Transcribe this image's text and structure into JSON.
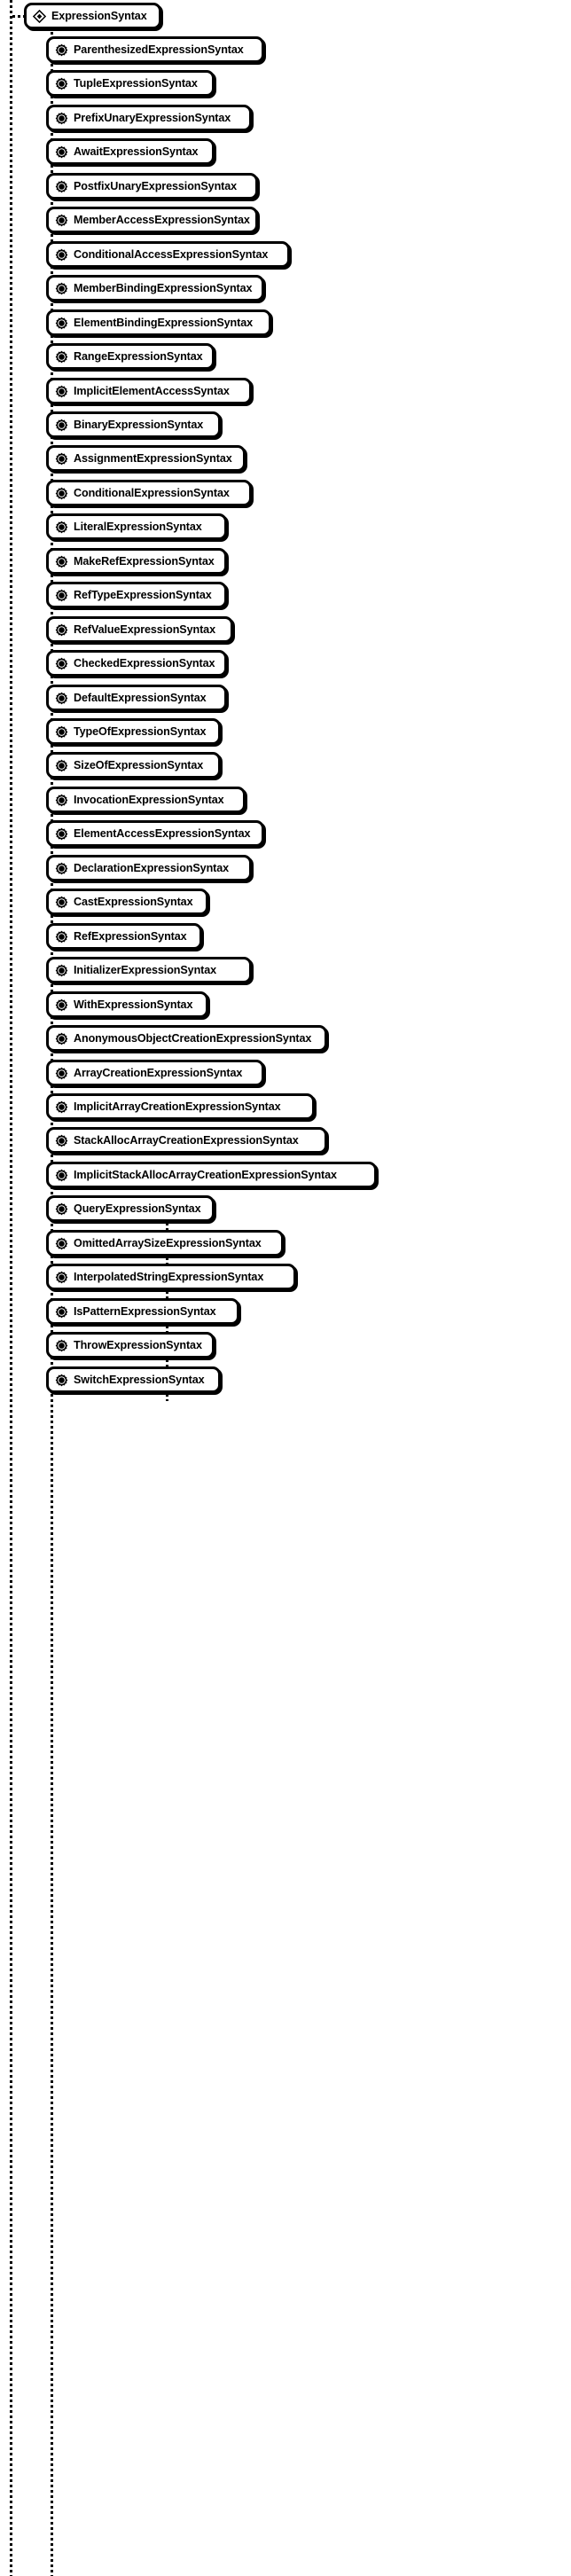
{
  "diagram": {
    "type": "class-hierarchy-tree",
    "title": "ExpressionSyntax",
    "root": {
      "label": "ExpressionSyntax",
      "icon": "abstract-class-diamond-icon",
      "kind": "abstract-class"
    },
    "icons": {
      "abstract": "abstract-class-diamond-icon",
      "concrete": "concrete-class-circle-icon"
    },
    "children": [
      {
        "label": "ParenthesizedExpressionSyntax",
        "icon": "concrete-class-circle-icon"
      },
      {
        "label": "TupleExpressionSyntax",
        "icon": "concrete-class-circle-icon"
      },
      {
        "label": "PrefixUnaryExpressionSyntax",
        "icon": "concrete-class-circle-icon"
      },
      {
        "label": "AwaitExpressionSyntax",
        "icon": "concrete-class-circle-icon"
      },
      {
        "label": "PostfixUnaryExpressionSyntax",
        "icon": "concrete-class-circle-icon"
      },
      {
        "label": "MemberAccessExpressionSyntax",
        "icon": "concrete-class-circle-icon"
      },
      {
        "label": "ConditionalAccessExpressionSyntax",
        "icon": "concrete-class-circle-icon"
      },
      {
        "label": "MemberBindingExpressionSyntax",
        "icon": "concrete-class-circle-icon"
      },
      {
        "label": "ElementBindingExpressionSyntax",
        "icon": "concrete-class-circle-icon"
      },
      {
        "label": "RangeExpressionSyntax",
        "icon": "concrete-class-circle-icon"
      },
      {
        "label": "ImplicitElementAccessSyntax",
        "icon": "concrete-class-circle-icon"
      },
      {
        "label": "BinaryExpressionSyntax",
        "icon": "concrete-class-circle-icon"
      },
      {
        "label": "AssignmentExpressionSyntax",
        "icon": "concrete-class-circle-icon"
      },
      {
        "label": "ConditionalExpressionSyntax",
        "icon": "concrete-class-circle-icon"
      },
      {
        "label": "LiteralExpressionSyntax",
        "icon": "concrete-class-circle-icon"
      },
      {
        "label": "MakeRefExpressionSyntax",
        "icon": "concrete-class-circle-icon"
      },
      {
        "label": "RefTypeExpressionSyntax",
        "icon": "concrete-class-circle-icon"
      },
      {
        "label": "RefValueExpressionSyntax",
        "icon": "concrete-class-circle-icon"
      },
      {
        "label": "CheckedExpressionSyntax",
        "icon": "concrete-class-circle-icon"
      },
      {
        "label": "DefaultExpressionSyntax",
        "icon": "concrete-class-circle-icon"
      },
      {
        "label": "TypeOfExpressionSyntax",
        "icon": "concrete-class-circle-icon"
      },
      {
        "label": "SizeOfExpressionSyntax",
        "icon": "concrete-class-circle-icon"
      },
      {
        "label": "InvocationExpressionSyntax",
        "icon": "concrete-class-circle-icon"
      },
      {
        "label": "ElementAccessExpressionSyntax",
        "icon": "concrete-class-circle-icon"
      },
      {
        "label": "DeclarationExpressionSyntax",
        "icon": "concrete-class-circle-icon"
      },
      {
        "label": "CastExpressionSyntax",
        "icon": "concrete-class-circle-icon"
      },
      {
        "label": "RefExpressionSyntax",
        "icon": "concrete-class-circle-icon"
      },
      {
        "label": "InitializerExpressionSyntax",
        "icon": "concrete-class-circle-icon"
      },
      {
        "label": "WithExpressionSyntax",
        "icon": "concrete-class-circle-icon"
      },
      {
        "label": "AnonymousObjectCreationExpressionSyntax",
        "icon": "concrete-class-circle-icon"
      },
      {
        "label": "ArrayCreationExpressionSyntax",
        "icon": "concrete-class-circle-icon"
      },
      {
        "label": "ImplicitArrayCreationExpressionSyntax",
        "icon": "concrete-class-circle-icon"
      },
      {
        "label": "StackAllocArrayCreationExpressionSyntax",
        "icon": "concrete-class-circle-icon"
      },
      {
        "label": "ImplicitStackAllocArrayCreationExpressionSyntax",
        "icon": "concrete-class-circle-icon"
      },
      {
        "label": "QueryExpressionSyntax",
        "icon": "concrete-class-circle-icon"
      },
      {
        "label": "OmittedArraySizeExpressionSyntax",
        "icon": "concrete-class-circle-icon"
      },
      {
        "label": "InterpolatedStringExpressionSyntax",
        "icon": "concrete-class-circle-icon"
      },
      {
        "label": "IsPatternExpressionSyntax",
        "icon": "concrete-class-circle-icon"
      },
      {
        "label": "ThrowExpressionSyntax",
        "icon": "concrete-class-circle-icon"
      },
      {
        "label": "SwitchExpressionSyntax",
        "icon": "concrete-class-circle-icon"
      }
    ]
  },
  "colors": {
    "stroke": "#000000",
    "background": "#ffffff",
    "text": "#000000"
  }
}
